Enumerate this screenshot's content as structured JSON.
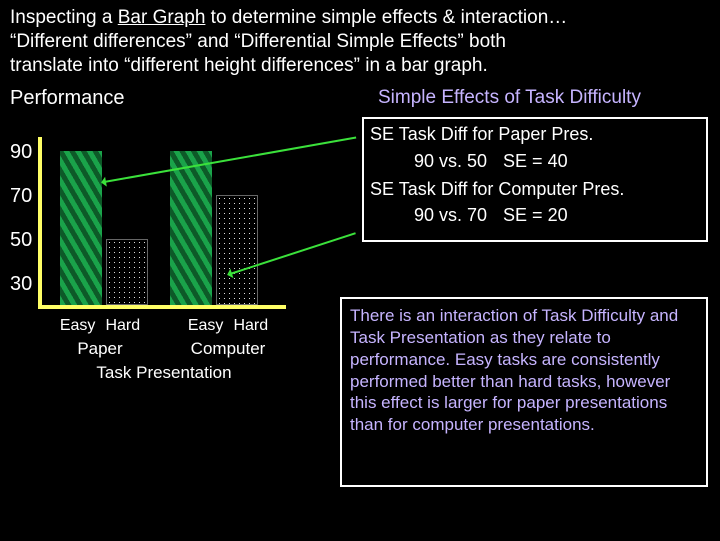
{
  "heading": {
    "line1_pre": "Inspecting a ",
    "line1_u": "Bar Graph",
    "line1_post": " to determine simple effects & interaction…",
    "line2": "“Different differences” and “Differential Simple Effects” both",
    "line3": "translate into “different height differences” in a bar graph."
  },
  "chart_data": {
    "type": "bar",
    "title": "Performance",
    "ylabel": "Performance",
    "xlabel": "Task Presentation",
    "ylim": [
      30,
      100
    ],
    "yticks": [
      90,
      70,
      50,
      30
    ],
    "groups": [
      "Paper",
      "Computer"
    ],
    "categories": [
      "Easy",
      "Hard"
    ],
    "series": [
      {
        "name": "Easy",
        "values": [
          90,
          90
        ]
      },
      {
        "name": "Hard",
        "values": [
          50,
          70
        ]
      }
    ],
    "group_cat_labels": {
      "g1c1": "Easy",
      "g1c2": "Hard",
      "g2c1": "Easy",
      "g2c2": "Hard"
    }
  },
  "right": {
    "title": "Simple Effects of Task Difficulty",
    "se_paper_label": "SE Task Diff for Paper Pres.",
    "se_paper_calc": "90 vs. 50",
    "se_paper_res": "SE = 40",
    "se_comp_label": "SE Task Diff for Computer Pres.",
    "se_comp_calc": "90 vs. 70",
    "se_comp_res": "SE = 20"
  },
  "interpretation": "There is an interaction of Task Difficulty and Task Presentation as they relate to performance. Easy tasks are consistently performed better than hard tasks, however this effect is larger for paper presentations than for computer presentations.",
  "colors": {
    "accent_yellow": "#ffff66",
    "accent_green": "#3be13b",
    "lavender": "#c6b4ff"
  }
}
